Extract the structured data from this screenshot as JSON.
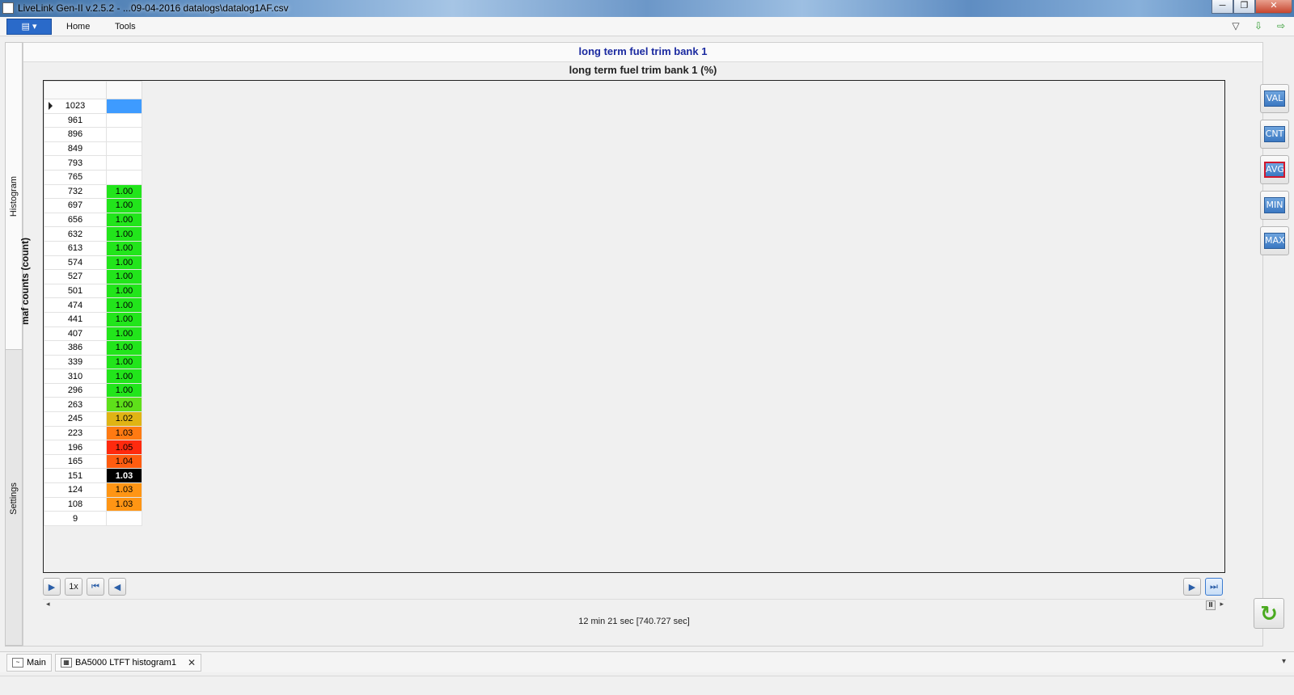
{
  "window": {
    "title": "LiveLink Gen-II  v.2.5.2 - ...09-04-2016 datalogs\\datalog1AF.csv",
    "min": "─",
    "max": "❐",
    "close": "✕"
  },
  "ribbon": {
    "app_menu": "▤ ▾",
    "tabs": [
      "Home",
      "Tools"
    ],
    "collapse_icon": "▽",
    "icon_a": "⇩",
    "icon_b": "⇨"
  },
  "side_tabs": [
    "Histogram",
    "Settings"
  ],
  "chart": {
    "title": "long term fuel trim bank 1",
    "column_title": "long term fuel trim bank 1 (%)",
    "row_axis_label": "maf counts (count)"
  },
  "table": {
    "rows": [
      {
        "idx": "1023",
        "val": "",
        "bg": "#3e9bff",
        "fg": "#000000",
        "current": true
      },
      {
        "idx": "961",
        "val": "",
        "bg": "#ffffff",
        "fg": "#000000"
      },
      {
        "idx": "896",
        "val": "",
        "bg": "#ffffff",
        "fg": "#000000"
      },
      {
        "idx": "849",
        "val": "",
        "bg": "#ffffff",
        "fg": "#000000"
      },
      {
        "idx": "793",
        "val": "",
        "bg": "#ffffff",
        "fg": "#000000"
      },
      {
        "idx": "765",
        "val": "",
        "bg": "#ffffff",
        "fg": "#000000"
      },
      {
        "idx": "732",
        "val": "1.00",
        "bg": "#22e51b",
        "fg": "#000000"
      },
      {
        "idx": "697",
        "val": "1.00",
        "bg": "#22e51b",
        "fg": "#000000"
      },
      {
        "idx": "656",
        "val": "1.00",
        "bg": "#22e51b",
        "fg": "#000000"
      },
      {
        "idx": "632",
        "val": "1.00",
        "bg": "#22e51b",
        "fg": "#000000"
      },
      {
        "idx": "613",
        "val": "1.00",
        "bg": "#22e51b",
        "fg": "#000000"
      },
      {
        "idx": "574",
        "val": "1.00",
        "bg": "#22e51b",
        "fg": "#000000"
      },
      {
        "idx": "527",
        "val": "1.00",
        "bg": "#22e51b",
        "fg": "#000000"
      },
      {
        "idx": "501",
        "val": "1.00",
        "bg": "#22e51b",
        "fg": "#000000"
      },
      {
        "idx": "474",
        "val": "1.00",
        "bg": "#22e51b",
        "fg": "#000000"
      },
      {
        "idx": "441",
        "val": "1.00",
        "bg": "#22e51b",
        "fg": "#000000"
      },
      {
        "idx": "407",
        "val": "1.00",
        "bg": "#22e51b",
        "fg": "#000000"
      },
      {
        "idx": "386",
        "val": "1.00",
        "bg": "#22e51b",
        "fg": "#000000"
      },
      {
        "idx": "339",
        "val": "1.00",
        "bg": "#22e51b",
        "fg": "#000000"
      },
      {
        "idx": "310",
        "val": "1.00",
        "bg": "#22e51b",
        "fg": "#000000"
      },
      {
        "idx": "296",
        "val": "1.00",
        "bg": "#22e51b",
        "fg": "#000000"
      },
      {
        "idx": "263",
        "val": "1.00",
        "bg": "#5ee01a",
        "fg": "#000000"
      },
      {
        "idx": "245",
        "val": "1.02",
        "bg": "#e0b414",
        "fg": "#000000"
      },
      {
        "idx": "223",
        "val": "1.03",
        "bg": "#ff7a12",
        "fg": "#000000"
      },
      {
        "idx": "196",
        "val": "1.05",
        "bg": "#ff2a0e",
        "fg": "#000000"
      },
      {
        "idx": "165",
        "val": "1.04",
        "bg": "#ff5c10",
        "fg": "#000000"
      },
      {
        "idx": "151",
        "val": "1.03",
        "bg": "#000000",
        "fg": "#ffffff",
        "bold": true
      },
      {
        "idx": "124",
        "val": "1.03",
        "bg": "#ff9514",
        "fg": "#000000"
      },
      {
        "idx": "108",
        "val": "1.03",
        "bg": "#ff9514",
        "fg": "#000000"
      },
      {
        "idx": "9",
        "val": "",
        "bg": "#ffffff",
        "fg": "#000000"
      }
    ]
  },
  "side_buttons": [
    {
      "label": "VAL",
      "active": false
    },
    {
      "label": "CNT",
      "active": false
    },
    {
      "label": "AVG",
      "active": true
    },
    {
      "label": "MIN",
      "active": false
    },
    {
      "label": "MAX",
      "active": false
    }
  ],
  "playback": {
    "play": "▶",
    "speed": "1x",
    "first": "⏮",
    "prev": "◀",
    "next": "▶",
    "last": "⏭",
    "scroll_left": "◂",
    "scroll_right": "▸",
    "thumb": "Ⅲ",
    "time": "12 min 21 sec [740.727 sec]",
    "refresh": "↻"
  },
  "doc_tabs": [
    {
      "label": "Main"
    },
    {
      "label": "BA5000 LTFT histogram1",
      "close": "✕"
    }
  ],
  "doc_tabs_menu": "▾"
}
